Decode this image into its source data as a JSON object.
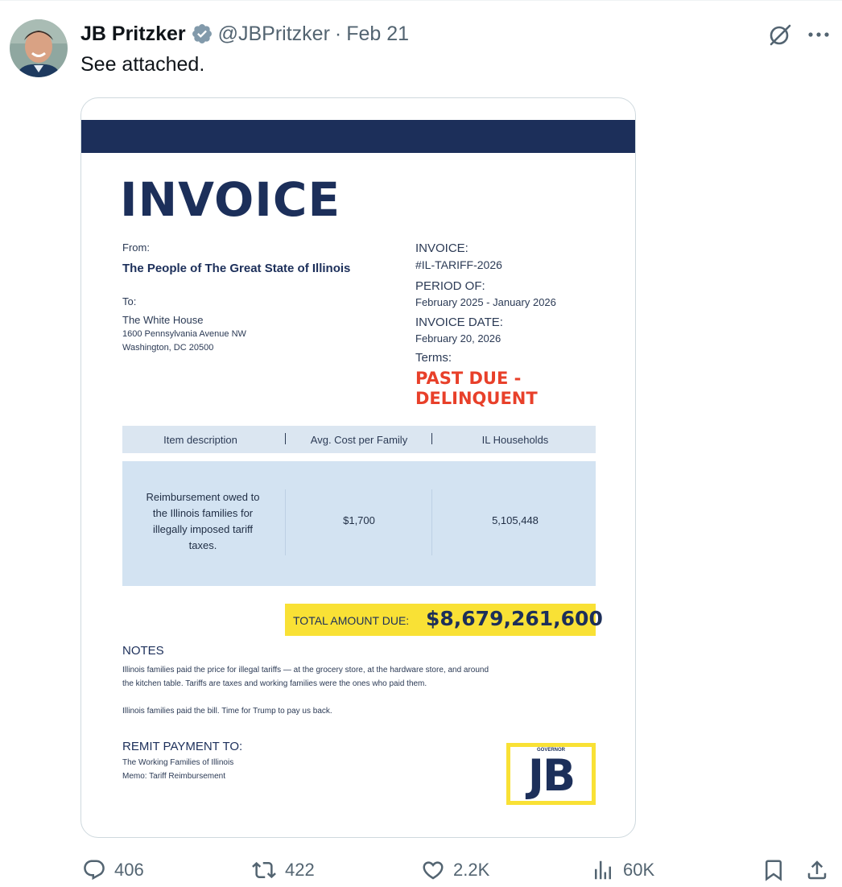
{
  "tweet": {
    "author_name": "JB Pritzker",
    "handle": "@JBPritzker",
    "separator": "·",
    "date": "Feb 21",
    "text": "See attached."
  },
  "invoice": {
    "title": "INVOICE",
    "from_label": "From:",
    "from_value": "The People of The Great State of Illinois",
    "to_label": "To:",
    "to_name": "The White House",
    "to_address_1": "1600 Pennsylvania Avenue NW",
    "to_address_2": "Washington, DC 20500",
    "invoice_label": "INVOICE:",
    "invoice_number": "#IL-TARIFF-2026",
    "period_label": "PERIOD OF:",
    "period_value": "February 2025 - January 2026",
    "date_label": "INVOICE DATE:",
    "date_value": "February 20, 2026",
    "terms_label": "Terms:",
    "terms_line_1": "PAST DUE -",
    "terms_line_2": "DELINQUENT",
    "table": {
      "headers": [
        "Item description",
        "Avg. Cost per Family",
        "IL Households"
      ],
      "row": {
        "description": "Reimbursement owed to the Illinois families for illegally imposed tariff taxes.",
        "avg_cost": "$1,700",
        "households": "5,105,448"
      }
    },
    "total_label": "TOTAL AMOUNT DUE:",
    "total_value": "$8,679,261,600",
    "notes_title": "NOTES",
    "notes_line_1": "Illinois families paid the price for illegal tariffs — at the grocery store, at the hardware store, and around",
    "notes_line_2": "the kitchen table. Tariffs are taxes and working families were the ones who paid them.",
    "notes_line_3": "Illinois families paid the bill. Time for Trump to pay us back.",
    "remit_title": "REMIT PAYMENT TO:",
    "remit_line_1": "The Working Families of Illinois",
    "remit_line_2": "Memo: Tariff Reimbursement",
    "logo_top": "GOVERNOR",
    "logo_main": "JB"
  },
  "actions": {
    "replies": "406",
    "reposts": "422",
    "likes": "2.2K",
    "views": "60K"
  },
  "colors": {
    "navy": "#1c2f5a",
    "alert_red": "#e8402a",
    "highlight_yellow": "#f9e135",
    "verified_blue": "#536471"
  },
  "icons": [
    "grok-icon",
    "more-icon",
    "verified-icon",
    "reply-icon",
    "repost-icon",
    "like-icon",
    "views-icon",
    "bookmark-icon",
    "share-icon"
  ]
}
